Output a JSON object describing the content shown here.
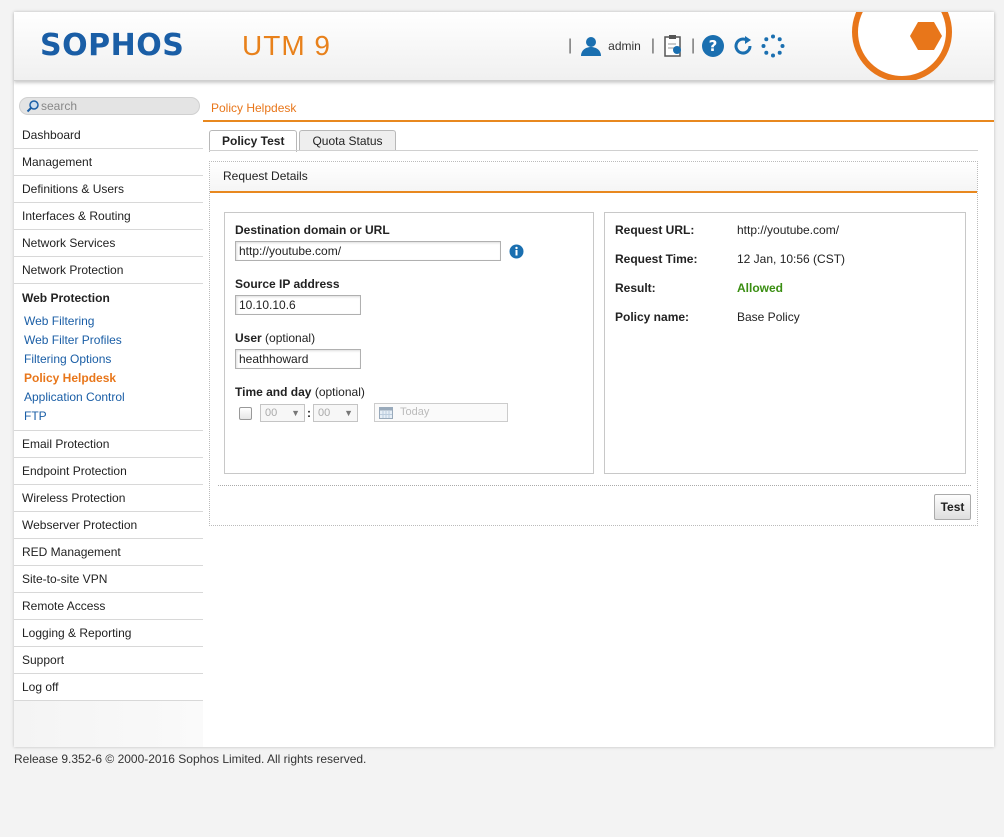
{
  "header": {
    "logo": "SOPHOS",
    "product": "UTM 9",
    "user": "admin",
    "separator": "|",
    "icons": [
      "user-icon",
      "notes-icon",
      "help-icon",
      "reload-icon",
      "activity-icon"
    ]
  },
  "search": {
    "placeholder": "search"
  },
  "sidebar": {
    "items": [
      {
        "label": "Dashboard"
      },
      {
        "label": "Management"
      },
      {
        "label": "Definitions & Users"
      },
      {
        "label": "Interfaces & Routing"
      },
      {
        "label": "Network Services"
      },
      {
        "label": "Network Protection"
      }
    ],
    "open_section": {
      "label": "Web Protection",
      "subitems": [
        {
          "label": "Web Filtering"
        },
        {
          "label": "Web Filter Profiles"
        },
        {
          "label": "Filtering Options"
        },
        {
          "label": "Policy Helpdesk"
        },
        {
          "label": "Application Control"
        },
        {
          "label": "FTP"
        }
      ]
    },
    "items_after": [
      {
        "label": "Email Protection"
      },
      {
        "label": "Endpoint Protection"
      },
      {
        "label": "Wireless Protection"
      },
      {
        "label": "Webserver Protection"
      },
      {
        "label": "RED Management"
      },
      {
        "label": "Site-to-site VPN"
      },
      {
        "label": "Remote Access"
      },
      {
        "label": "Logging & Reporting"
      },
      {
        "label": "Support"
      },
      {
        "label": "Log off"
      }
    ]
  },
  "page": {
    "breadcrumb": "Policy Helpdesk",
    "tabs": [
      {
        "label": "Policy Test"
      },
      {
        "label": "Quota Status"
      }
    ],
    "panel_title": "Request Details"
  },
  "form": {
    "dest_label": "Destination domain or URL",
    "dest_value": "http://youtube.com/",
    "source_label": "Source IP address",
    "source_value": "10.10.10.6",
    "user_label": "User",
    "user_optional": "(optional)",
    "user_value": "heathhoward",
    "time_label": "Time and day",
    "time_optional": "(optional)",
    "hour": "00",
    "minute": "00",
    "colon": ":",
    "date_placeholder": "Today"
  },
  "result": {
    "url_label": "Request URL:",
    "url_value": "http://youtube.com/",
    "time_label": "Request Time:",
    "time_value": "12 Jan, 10:56 (CST)",
    "result_label": "Result:",
    "result_value": "Allowed",
    "policy_label": "Policy name:",
    "policy_value": "Base Policy"
  },
  "actions": {
    "test_label": "Test"
  },
  "footer": {
    "text": "Release 9.352-6  © 2000-2016 Sophos Limited. All rights reserved."
  },
  "colors": {
    "accent": "#e8761a",
    "brand_blue": "#1a5ea6",
    "allowed_green": "#3a8e12"
  }
}
